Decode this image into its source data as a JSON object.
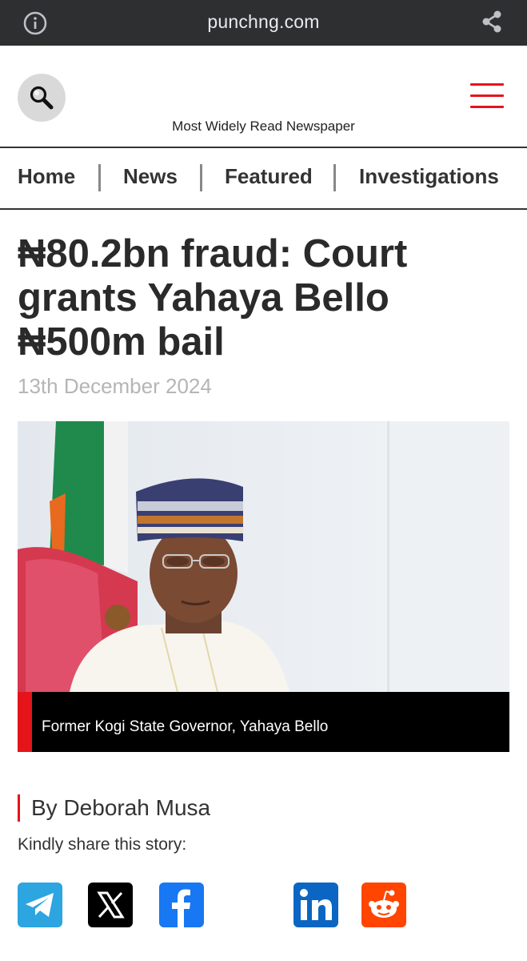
{
  "browser": {
    "url": "punchng.com",
    "info_icon": "info-icon",
    "share_icon": "share-icon"
  },
  "header": {
    "tagline": "Most Widely Read Newspaper",
    "search_icon": "search-icon",
    "menu_icon": "hamburger-menu-icon",
    "accent_color": "#e5141b"
  },
  "nav": {
    "items": [
      "Home",
      "News",
      "Featured",
      "Investigations"
    ]
  },
  "article": {
    "title": "₦80.2bn fraud: Court grants Yahaya Bello ₦500m bail",
    "date": "13th December 2024",
    "image_caption": "Former Kogi State Governor, Yahaya Bello",
    "byline": "By Deborah Musa",
    "share_prompt": "Kindly share this story:"
  },
  "share_buttons": [
    {
      "name": "telegram-icon",
      "color": "#2ca5e0"
    },
    {
      "name": "x-icon",
      "color": "#000000"
    },
    {
      "name": "facebook-icon",
      "color": "#1877f2"
    },
    {
      "name": "linkedin-icon",
      "color": "#0a66c2"
    },
    {
      "name": "reddit-icon",
      "color": "#ff4500"
    }
  ]
}
